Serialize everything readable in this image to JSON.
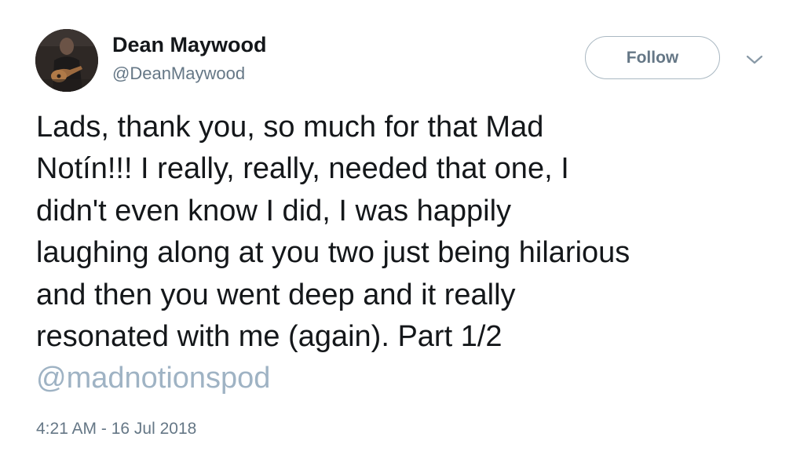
{
  "user": {
    "display_name": "Dean Maywood",
    "handle": "@DeanMaywood",
    "avatar_icon": "profile-photo-guitar"
  },
  "actions": {
    "follow_label": "Follow",
    "menu_icon": "chevron-down-icon"
  },
  "tweet": {
    "lines": [
      "Lads, thank you, so much for that Mad",
      "Notín!!! I really, really, needed that one, I",
      "didn't even know I did, I was happily",
      "laughing along at you two just being hilarious",
      "and then you went deep and it really",
      "resonated with me (again). Part 1/2"
    ],
    "mention": "@madnotionspod",
    "timestamp": "4:21 AM - 16 Jul 2018"
  },
  "colors": {
    "text": "#14171a",
    "secondary": "#657786",
    "mention": "#9fb3c4",
    "follow_border": "#aab8c2"
  }
}
